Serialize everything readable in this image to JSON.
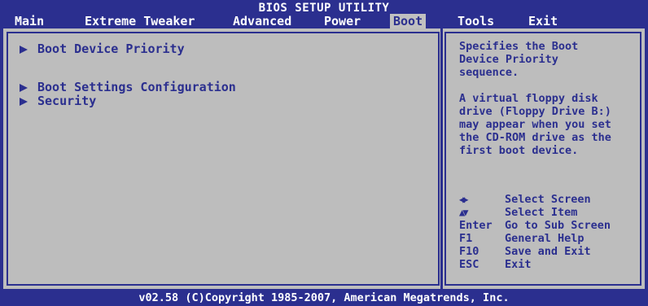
{
  "header": {
    "title": "BIOS SETUP UTILITY"
  },
  "menu": [
    {
      "label": "Main"
    },
    {
      "label": "Extreme Tweaker"
    },
    {
      "label": "Advanced"
    },
    {
      "label": "Power"
    },
    {
      "label": "Boot"
    },
    {
      "label": "Tools"
    },
    {
      "label": "Exit"
    }
  ],
  "active_menu": "Boot",
  "entries": [
    {
      "label": "Boot Device Priority"
    },
    {
      "label": "Boot Settings Configuration"
    },
    {
      "label": "Security"
    }
  ],
  "help": {
    "text": "Specifies the Boot\nDevice Priority\nsequence.\n\nA virtual floppy disk\ndrive (Floppy Drive B:)\nmay appear when you set\nthe CD-ROM drive as the\nfirst boot device."
  },
  "keys": [
    {
      "key": "",
      "icon": "left-right-arrows-icon",
      "desc": "Select Screen"
    },
    {
      "key": "",
      "icon": "up-down-arrows-icon",
      "desc": "Select Item"
    },
    {
      "key": "Enter",
      "desc": "Go to Sub Screen"
    },
    {
      "key": "F1",
      "desc": "General Help"
    },
    {
      "key": "F10",
      "desc": "Save and Exit"
    },
    {
      "key": "ESC",
      "desc": "Exit"
    }
  ],
  "footer": {
    "text": "v02.58 (C)Copyright 1985-2007, American Megatrends, Inc."
  },
  "colors": {
    "background": "#2b2f8f",
    "panel": "#bdbdbd",
    "text_dark": "#2b2f8f",
    "text_light": "#ffffff"
  }
}
